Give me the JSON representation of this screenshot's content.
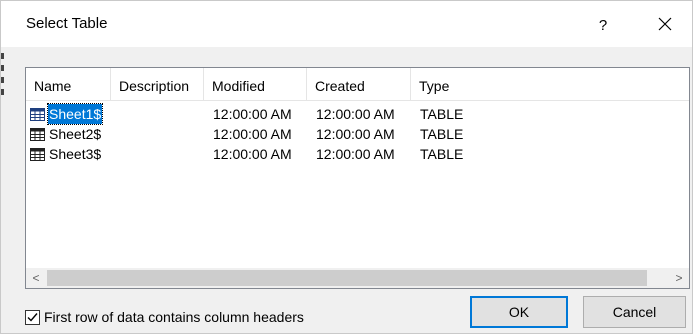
{
  "window": {
    "title": "Select Table",
    "help_label": "?",
    "close_icon": "close-icon"
  },
  "list": {
    "columns": [
      {
        "label": "Name"
      },
      {
        "label": "Description"
      },
      {
        "label": "Modified"
      },
      {
        "label": "Created"
      },
      {
        "label": "Type"
      }
    ],
    "rows": [
      {
        "name": "Sheet1$",
        "description": "",
        "modified": "12:00:00 AM",
        "created": "12:00:00 AM",
        "type": "TABLE",
        "selected": true
      },
      {
        "name": "Sheet2$",
        "description": "",
        "modified": "12:00:00 AM",
        "created": "12:00:00 AM",
        "type": "TABLE",
        "selected": false
      },
      {
        "name": "Sheet3$",
        "description": "",
        "modified": "12:00:00 AM",
        "created": "12:00:00 AM",
        "type": "TABLE",
        "selected": false
      }
    ],
    "row_icon": "table-icon",
    "scroll_left_glyph": "<",
    "scroll_right_glyph": ">"
  },
  "options": {
    "first_row_headers_label": "First row of data contains column headers",
    "first_row_headers_checked": true
  },
  "buttons": {
    "ok_label": "OK",
    "cancel_label": "Cancel"
  },
  "colors": {
    "selection": "#0078d7",
    "default_button_border": "#0078d7",
    "dialog_bg": "#f0f0f0"
  }
}
